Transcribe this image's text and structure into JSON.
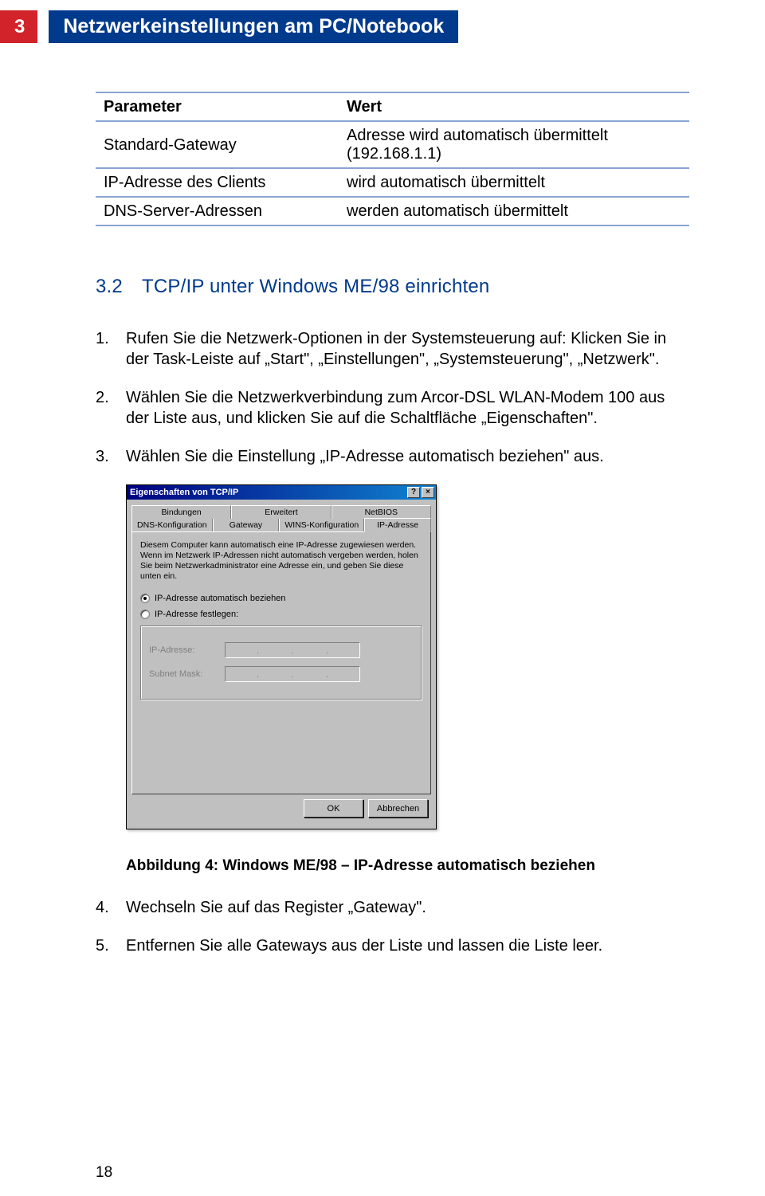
{
  "header": {
    "chapter_number": "3",
    "chapter_title": "Netzwerkeinstellungen am PC/Notebook"
  },
  "param_table": {
    "head": {
      "c1": "Parameter",
      "c2": "Wert"
    },
    "rows": [
      {
        "c1": "Standard-Gateway",
        "c2": "Adresse wird automatisch übermittelt (192.168.1.1)"
      },
      {
        "c1": "IP-Adresse des Clients",
        "c2": "wird automatisch übermittelt"
      },
      {
        "c1": "DNS-Server-Adressen",
        "c2": "werden automatisch übermittelt"
      }
    ]
  },
  "section": {
    "number": "3.2",
    "title": "TCP/IP unter Windows ME/98 einrichten"
  },
  "steps_a": [
    "Rufen Sie die Netzwerk-Optionen in der Systemsteuerung auf: Klicken Sie in der Task-Leiste auf „Start\", „Einstellungen\", „Systemsteuerung\", „Netzwerk\".",
    "Wählen Sie die Netzwerkverbindung zum Arcor-DSL WLAN-Modem 100 aus der Liste aus, und klicken Sie auf die Schaltfläche „Eigenschaften\".",
    "Wählen Sie die Einstellung „IP-Adresse automatisch beziehen\" aus."
  ],
  "dialog": {
    "title": "Eigenschaften von TCP/IP",
    "help_btn": "?",
    "close_btn": "×",
    "tabs_back": [
      "Bindungen",
      "Erweitert",
      "NetBIOS"
    ],
    "tabs_front": [
      "DNS-Konfiguration",
      "Gateway",
      "WINS-Konfiguration",
      "IP-Adresse"
    ],
    "active_tab": "IP-Adresse",
    "blurb": "Diesem Computer kann automatisch eine IP-Adresse zugewiesen werden. Wenn im Netzwerk IP-Adressen nicht automatisch vergeben werden, holen Sie beim Netzwerkadministrator eine Adresse ein, und geben Sie diese unten ein.",
    "radio_auto": "IP-Adresse automatisch beziehen",
    "radio_fixed": "IP-Adresse festlegen:",
    "lbl_ip": "IP-Adresse:",
    "lbl_subnet": "Subnet Mask:",
    "ok": "OK",
    "cancel": "Abbrechen"
  },
  "caption": "Abbildung 4: Windows ME/98 – IP-Adresse automatisch beziehen",
  "steps_b": [
    {
      "n": "4.",
      "t": "Wechseln Sie auf das Register „Gateway\"."
    },
    {
      "n": "5.",
      "t": "Entfernen Sie alle Gateways aus der Liste und lassen die Liste leer."
    }
  ],
  "footer_page": "18"
}
